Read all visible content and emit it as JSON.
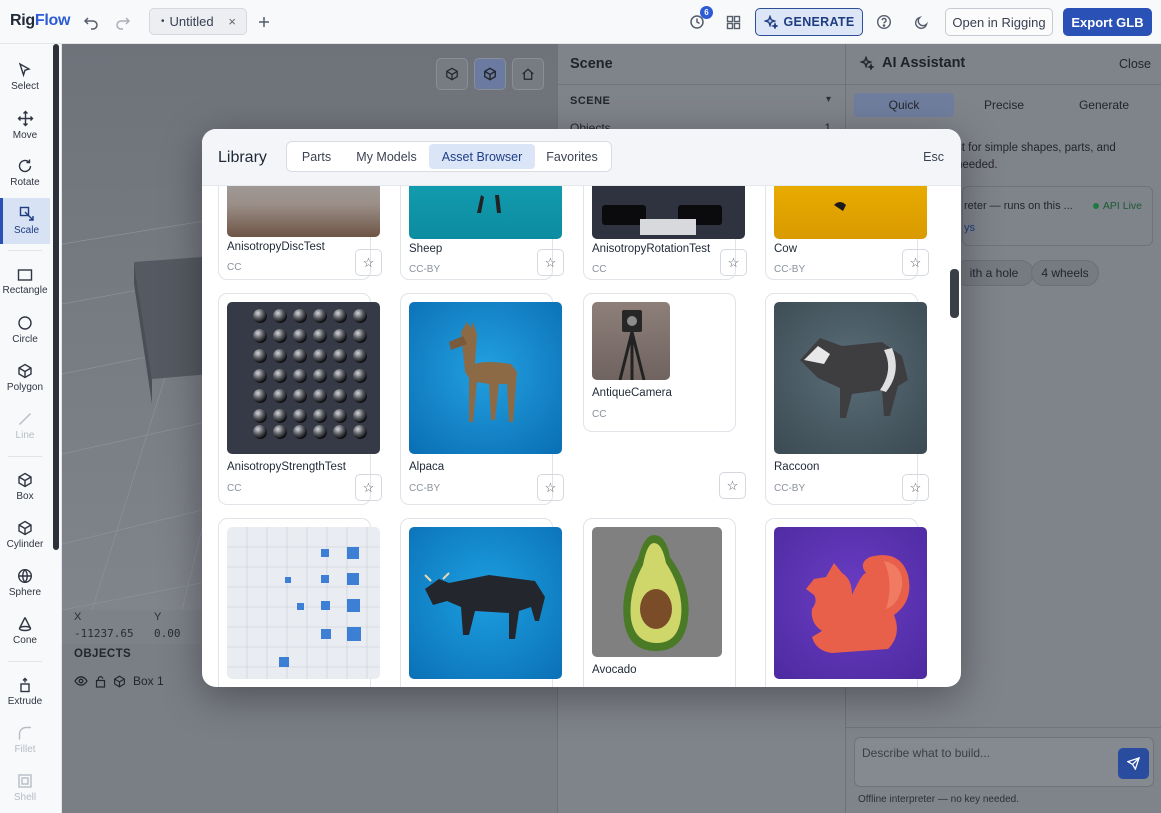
{
  "app": {
    "brand_left": "Rig",
    "brand_right": "Flow"
  },
  "tab": {
    "dot": "•",
    "title": "Untitled",
    "close": "×"
  },
  "history_badge": "6",
  "header": {
    "generate": "GENERATE",
    "open_rigging": "Open in Rigging",
    "export": "Export GLB"
  },
  "tools": [
    {
      "label": "Select",
      "icon": "cursor-icon"
    },
    {
      "label": "Move",
      "icon": "move-icon"
    },
    {
      "label": "Rotate",
      "icon": "rotate-icon"
    },
    {
      "label": "Scale",
      "icon": "scale-icon",
      "active": true
    },
    {
      "label": "Rectangle",
      "icon": "rectangle-icon"
    },
    {
      "label": "Circle",
      "icon": "circle-icon"
    },
    {
      "label": "Polygon",
      "icon": "polygon-icon"
    },
    {
      "label": "Line",
      "icon": "line-icon",
      "disabled": true
    },
    {
      "label": "Box",
      "icon": "box-icon"
    },
    {
      "label": "Cylinder",
      "icon": "cylinder-icon"
    },
    {
      "label": "Sphere",
      "icon": "sphere-icon"
    },
    {
      "label": "Cone",
      "icon": "cone-icon"
    },
    {
      "label": "Extrude",
      "icon": "extrude-icon"
    },
    {
      "label": "Fillet",
      "icon": "fillet-icon",
      "disabled": true
    },
    {
      "label": "Shell",
      "icon": "shell-icon",
      "disabled": true
    }
  ],
  "coords": {
    "x_label": "X",
    "y_label": "Y",
    "x_value": "-11237.65",
    "y_value": "0.00"
  },
  "objects": {
    "header": "OBJECTS",
    "item": "Box 1"
  },
  "scene": {
    "title": "Scene",
    "section": "SCENE",
    "row_label": "Objects",
    "row_count": "1"
  },
  "ai": {
    "title": "AI Assistant",
    "close": "Close",
    "tabs": [
      "Quick",
      "Precise",
      "Generate"
    ],
    "hint_line1": "st for simple shapes, parts, and",
    "hint_line2": "needed.",
    "interpreter": "reter — runs on this ...",
    "api_live": "API Live",
    "keys": "ys",
    "chips": [
      "ith a hole",
      "4 wheels"
    ],
    "placeholder": "Describe what to build...",
    "footer": "Offline interpreter — no key needed."
  },
  "library": {
    "title": "Library",
    "tabs": [
      "Parts",
      "My Models",
      "Asset Browser",
      "Favorites"
    ],
    "active_tab": "Asset Browser",
    "esc": "Esc",
    "row1": [
      {
        "name": "AnisotropyDiscTest",
        "license": "CC"
      },
      {
        "name": "Sheep",
        "license": "CC-BY"
      },
      {
        "name": "AnisotropyRotationTest",
        "license": "CC"
      },
      {
        "name": "Cow",
        "license": "CC-BY"
      }
    ],
    "row2": [
      {
        "name": "AnisotropyStrengthTest",
        "license": "CC"
      },
      {
        "name": "Alpaca",
        "license": "CC-BY"
      },
      {
        "name": "AntiqueCamera",
        "license": "CC"
      },
      {
        "name": "Raccoon",
        "license": "CC-BY"
      }
    ],
    "row3": [
      {
        "name": "",
        "license": ""
      },
      {
        "name": "",
        "license": ""
      },
      {
        "name": "Avocado",
        "license": ""
      },
      {
        "name": "",
        "license": ""
      }
    ]
  },
  "colors": {
    "accent": "#2a51b5",
    "active_tab": "#dbe5f8",
    "api_live": "#1f7a41"
  }
}
